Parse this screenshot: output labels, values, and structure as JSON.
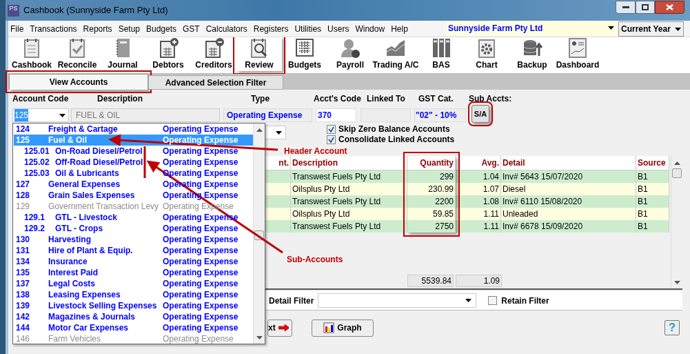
{
  "window": {
    "title": "Cashbook (Sunnyside Farm Pty Ltd)",
    "app_icon": "PS"
  },
  "menu": [
    "File",
    "Transactions",
    "Reports",
    "Setup",
    "Budgets",
    "GST",
    "Calculators",
    "Registers",
    "Utilities",
    "Users",
    "Window",
    "Help"
  ],
  "company": "Sunnyside Farm Pty Ltd",
  "period": "Current Year",
  "toolbar": [
    {
      "label": "Cashbook",
      "kind": "notepad",
      "annotated": false
    },
    {
      "label": "Reconcile",
      "kind": "check",
      "annotated": false
    },
    {
      "label": "Journal",
      "kind": "book",
      "annotated": false
    },
    {
      "label": "Debtors",
      "kind": "plus",
      "annotated": false
    },
    {
      "label": "Creditors",
      "kind": "minus",
      "annotated": false
    },
    {
      "label": "Review",
      "kind": "magnifier",
      "annotated": true
    },
    {
      "label": "Budgets",
      "kind": "grid",
      "annotated": false
    },
    {
      "label": "Payroll",
      "kind": "person",
      "annotated": false
    },
    {
      "label": "Trading A/C",
      "kind": "area",
      "annotated": false
    },
    {
      "label": "BAS",
      "kind": "binders",
      "annotated": false
    },
    {
      "label": "Chart",
      "kind": "gear",
      "annotated": false
    },
    {
      "label": "Backup",
      "kind": "database",
      "annotated": false
    },
    {
      "label": "Dashboard",
      "kind": "dashboard",
      "annotated": false
    }
  ],
  "tabs": [
    {
      "label": "View Accounts",
      "selected": true,
      "annotated": true
    },
    {
      "label": "Advanced Selection Filter",
      "selected": false,
      "annotated": false
    }
  ],
  "fields": {
    "labels": [
      "Account Code",
      "Description",
      "Type",
      "Acct's Code",
      "Linked To",
      "GST Cat.",
      "Sub Accts:"
    ],
    "account_code": "125",
    "description": "FUEL & OIL",
    "type": "Operating Expense",
    "accts_code": "370",
    "gst_cat": "\"02\" - 10%",
    "sub_accts_button": {
      "label": "S/A",
      "annotated": true
    }
  },
  "options": [
    {
      "label": "Skip Zero Balance Accounts",
      "checked": true
    },
    {
      "label": "Consolidate Linked Accounts",
      "checked": true
    }
  ],
  "table": {
    "columns": [
      {
        "label": "nt.",
        "annotated": false
      },
      {
        "label": "Description",
        "annotated": false
      },
      {
        "label": "Quantity",
        "annotated": true
      },
      {
        "label": "Avg.",
        "annotated": false
      },
      {
        "label": "Detail",
        "annotated": false
      },
      {
        "label": "Source",
        "annotated": false
      }
    ],
    "rows": [
      [
        "",
        "Transwest Fuels Pty Ltd",
        "299",
        "1.04",
        "Inv# 5643 15/07/2020",
        "B1"
      ],
      [
        "",
        "Oilsplus Pty Ltd",
        "230.99",
        "1.07",
        "Diesel",
        "B1"
      ],
      [
        "",
        "Transwest Fuels Pty Ltd",
        "2200",
        "1.08",
        "Inv# 6110 15/08/2020",
        "B1"
      ],
      [
        "",
        "Oilsplus Pty Ltd",
        "59.85",
        "1.11",
        "Unleaded",
        "B1"
      ],
      [
        "",
        "Transwest Fuels Pty Ltd",
        "2750",
        "1.11",
        "Inv# 6678 15/09/2020",
        "B1"
      ]
    ],
    "totals": [
      "5539.84",
      "1.09"
    ]
  },
  "detail_filter": {
    "label": "Detail Filter"
  },
  "retain_filter": {
    "label": "Retain Filter",
    "checked": false
  },
  "buttons": [
    {
      "label": "xt",
      "kind": "next"
    },
    {
      "label": "Graph",
      "kind": "graph"
    }
  ],
  "help": "?",
  "account_list": [
    {
      "code": "124",
      "name": "Freight & Cartage",
      "type": "Operating Expense",
      "selected": false,
      "disabled": false
    },
    {
      "code": "125",
      "name": "Fuel & Oil",
      "type": "Operating Expense",
      "selected": true,
      "disabled": false,
      "children": [
        {
          "code": "125.01",
          "name": "On-Road Diesel/Petrol",
          "type": "Operating Expense",
          "selected": false,
          "disabled": false
        },
        {
          "code": "125.02",
          "name": "Off-Road Diesel/Petrol",
          "type": "Operating Expense",
          "selected": false,
          "disabled": false
        },
        {
          "code": "125.03",
          "name": "Oil & Lubricants",
          "type": "Operating Expense",
          "selected": false,
          "disabled": false
        }
      ]
    },
    {
      "code": "127",
      "name": "General Expenses",
      "type": "Operating Expense",
      "selected": false,
      "disabled": false
    },
    {
      "code": "128",
      "name": "Grain Sales Expenses",
      "type": "Operating Expense",
      "selected": false,
      "disabled": false
    },
    {
      "code": "129",
      "name": "Government Transaction Levy",
      "type": "Operating Expense",
      "selected": false,
      "disabled": true,
      "children": [
        {
          "code": "129.1",
          "name": "GTL - Livestock",
          "type": "Operating Expense",
          "selected": false,
          "disabled": false
        },
        {
          "code": "129.2",
          "name": "GTL - Crops",
          "type": "Operating Expense",
          "selected": false,
          "disabled": false
        }
      ]
    },
    {
      "code": "130",
      "name": "Harvesting",
      "type": "Operating Expense",
      "selected": false,
      "disabled": false
    },
    {
      "code": "131",
      "name": "Hire of Plant & Equip.",
      "type": "Operating Expense",
      "selected": false,
      "disabled": false
    },
    {
      "code": "134",
      "name": "Insurance",
      "type": "Operating Expense",
      "selected": false,
      "disabled": false
    },
    {
      "code": "135",
      "name": "Interest Paid",
      "type": "Operating Expense",
      "selected": false,
      "disabled": false
    },
    {
      "code": "137",
      "name": "Legal Costs",
      "type": "Operating Expense",
      "selected": false,
      "disabled": false
    },
    {
      "code": "138",
      "name": "Leasing Expenses",
      "type": "Operating Expense",
      "selected": false,
      "disabled": false
    },
    {
      "code": "139",
      "name": "Livestock Selling Expenses",
      "type": "Operating Expense",
      "selected": false,
      "disabled": false
    },
    {
      "code": "142",
      "name": "Magazines & Journals",
      "type": "Operating Expense",
      "selected": false,
      "disabled": false
    },
    {
      "code": "144",
      "name": "Motor Car Expenses",
      "type": "Operating Expense",
      "selected": false,
      "disabled": false
    },
    {
      "code": "146",
      "name": "Farm Vehicles",
      "type": "Operating Expense",
      "selected": false,
      "disabled": true
    }
  ],
  "callouts": [
    {
      "text": "Header Account"
    },
    {
      "text": "Sub-Accounts"
    }
  ]
}
